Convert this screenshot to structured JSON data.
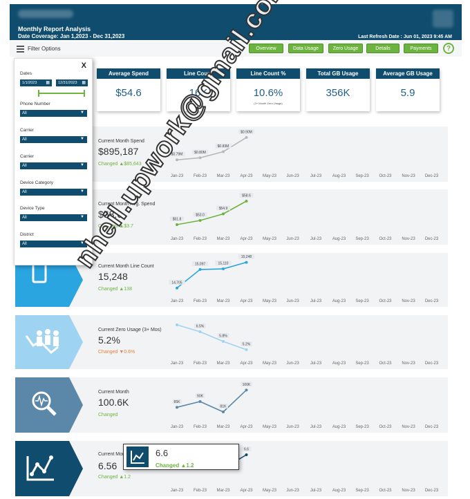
{
  "header": {
    "title": "Monthly Report Analysis",
    "coverage": "Date Coverage: Jan 1,2023 - Dec 31,2023",
    "refresh": "Last Refresh Date : Jun 01, 2023 9:45 AM"
  },
  "filter_bar": {
    "label": "Filter Options",
    "nav": [
      "Overview",
      "Data Usage",
      "Zero Usage",
      "Details",
      "Payments"
    ],
    "help": "?"
  },
  "kpis": [
    {
      "title": "Average Spend",
      "value": "$54.6",
      "note": ""
    },
    {
      "title": "Line Count",
      "value": "16K",
      "note": ""
    },
    {
      "title": "Line Count %",
      "value": "10.6%",
      "note": "(3+ Month Zero Usage)"
    },
    {
      "title": "Total GB Usage",
      "value": "356K",
      "note": ""
    },
    {
      "title": "Average GB Usage",
      "value": "5.9",
      "note": ""
    }
  ],
  "months": [
    "Jan-23",
    "Feb-23",
    "Mar-23",
    "Apr-23",
    "May-23",
    "Jun-23",
    "Jul-23",
    "Aug-23",
    "Sep-23",
    "Oct-23",
    "Nov-23",
    "Dec-23"
  ],
  "rows": [
    {
      "label": "Current Month Spend",
      "value": "$895,187",
      "changed": "Changed ▲$85,643",
      "direction": "up",
      "color": "#b8b8b8",
      "points": [
        0.79,
        0.8,
        0.83,
        0.9
      ],
      "point_labels": [
        "$0.79M",
        "$0.80M",
        "$0.83M",
        "$0.90M"
      ],
      "ylim": [
        0.75,
        0.92
      ]
    },
    {
      "label": "Current Month Avg. Spend",
      "value": "$58.6",
      "changed": "Changed ▲$3.7",
      "direction": "up",
      "color": "#6db33f",
      "points": [
        51.8,
        53.0,
        54.9,
        58.6
      ],
      "point_labels": [
        "$51.8",
        "$53.0",
        "$54.9",
        "$58.6"
      ],
      "ylim": [
        50,
        60
      ]
    },
    {
      "label": "Current Month Line Count",
      "value": "15,248",
      "changed": "Changed ▲138",
      "direction": "up",
      "color": "#2aa5e0",
      "points": [
        14.705,
        15.097,
        15.11,
        15.248
      ],
      "point_labels": [
        "14,705",
        "15,097",
        "15,110",
        "15,248"
      ],
      "ylim": [
        14.6,
        15.3
      ]
    },
    {
      "label": "Current Zero Usage (3+ Mos)",
      "value": "5.2%",
      "changed": "Changed ▼0.6%",
      "direction": "down",
      "color": "#9fd3f2",
      "points": [
        7.0,
        6.5,
        5.8,
        5.2
      ],
      "point_labels": [
        "",
        "6.5%",
        "5.8%",
        "5.2%"
      ],
      "ylim": [
        4.8,
        7.2
      ]
    },
    {
      "label": "Current Month",
      "value": "100.6K",
      "changed": "Changed",
      "direction": "up",
      "color": "#5b87a8",
      "points": [
        85,
        90,
        81,
        100
      ],
      "point_labels": [
        "85K",
        "90K",
        "81K",
        "100K"
      ],
      "ylim": [
        75,
        105
      ]
    },
    {
      "label": "Current Month",
      "value": "6.56",
      "changed": "Changed ▲1.2",
      "direction": "up",
      "color": "#0f4c6e",
      "points": [
        0,
        0,
        5.8,
        6.6
      ],
      "point_labels": [
        "",
        "",
        "",
        "6.6"
      ],
      "ylim": [
        5.0,
        7.0
      ]
    }
  ],
  "filters": {
    "close": "X",
    "dates_label": "Dates",
    "start_date": "1/1/2023",
    "end_date": "12/31/2023",
    "fields": [
      {
        "label": "Phone Number",
        "value": "All"
      },
      {
        "label": "Carrier",
        "value": "All"
      },
      {
        "label": "Carrier",
        "value": "All"
      },
      {
        "label": "Device Category",
        "value": "All"
      },
      {
        "label": "Device Type",
        "value": "All"
      },
      {
        "label": "District",
        "value": "All"
      }
    ]
  },
  "tooltip": {
    "value": "6.6",
    "changed": "Changed ▲1.2"
  },
  "watermark": "nheil.upwork@gmail.com",
  "colors": {
    "navy": "#0f4c6e",
    "green": "#6db33f",
    "light_blue": "#2aa5e0",
    "orange": "#e8803a"
  }
}
